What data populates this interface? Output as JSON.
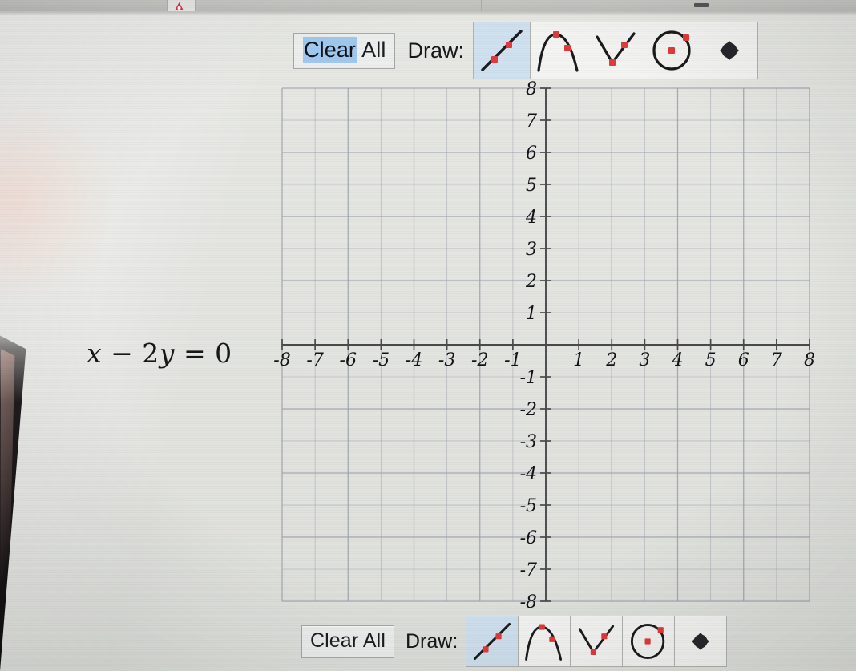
{
  "app": {
    "equation": "x − 2y = 0",
    "equation_parts": {
      "x": "x",
      "minus": "−",
      "coef": "2",
      "y": "y",
      "eq": "=",
      "rhs": "0"
    }
  },
  "toolbar_top": {
    "clear_button_label": "Clear All",
    "clear_selected_text": "Clear",
    "clear_rest_text": " All",
    "draw_label": "Draw:",
    "selected_tool": "line",
    "tools": [
      {
        "id": "line",
        "name": "line-tool",
        "label": "Line",
        "selected": true
      },
      {
        "id": "parabola",
        "name": "parabola-tool",
        "label": "Parabola",
        "selected": false
      },
      {
        "id": "absolute",
        "name": "absolute-value-tool",
        "label": "Absolute Value",
        "selected": false
      },
      {
        "id": "circle",
        "name": "circle-tool",
        "label": "Circle",
        "selected": false
      },
      {
        "id": "point",
        "name": "point-tool",
        "label": "Point",
        "selected": false
      }
    ]
  },
  "toolbar_bottom": {
    "clear_button_label": "Clear All",
    "draw_label": "Draw:",
    "selected_tool": "line",
    "tools": [
      {
        "id": "line",
        "name": "line-tool",
        "label": "Line",
        "selected": true
      },
      {
        "id": "parabola",
        "name": "parabola-tool",
        "label": "Parabola",
        "selected": false
      },
      {
        "id": "absolute",
        "name": "absolute-value-tool",
        "label": "Absolute Value",
        "selected": false
      },
      {
        "id": "circle",
        "name": "circle-tool",
        "label": "Circle",
        "selected": false
      },
      {
        "id": "point",
        "name": "point-tool",
        "label": "Point",
        "selected": false
      }
    ]
  },
  "chart_data": {
    "type": "line",
    "title": "",
    "xlabel": "",
    "ylabel": "",
    "xlim": [
      -8,
      8
    ],
    "ylim": [
      -8,
      8
    ],
    "grid": true,
    "grid_step": 1,
    "tick_step": 1,
    "legend": "none",
    "x_tick_labels": [
      "-8",
      "-7",
      "-6",
      "-5",
      "-4",
      "-3",
      "-2",
      "-1",
      "1",
      "2",
      "3",
      "4",
      "5",
      "6",
      "7",
      "8"
    ],
    "y_tick_labels": [
      "8",
      "7",
      "6",
      "5",
      "4",
      "3",
      "2",
      "1",
      "-1",
      "-2",
      "-3",
      "-4",
      "-5",
      "-6",
      "-7",
      "-8"
    ],
    "series": [],
    "annotations": [],
    "plotted_equation": "x - 2y = 0",
    "plotted": false,
    "colors": {
      "grid": "#9aa0ab",
      "axis": "#4a4a4c",
      "label": "#1a1a1c",
      "marker": "#e23a3a",
      "curve": "#1b1b1d",
      "selected_tool_bg": "#cfe0ee",
      "selection_highlight": "#9fc8ef"
    }
  }
}
